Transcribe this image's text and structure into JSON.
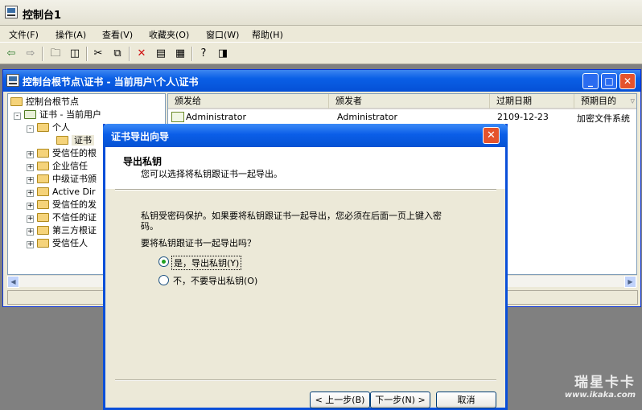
{
  "app": {
    "title": "控制台1"
  },
  "menubar": [
    {
      "label": "文件(F)"
    },
    {
      "label": "操作(A)"
    },
    {
      "label": "查看(V)"
    },
    {
      "label": "收藏夹(O)"
    },
    {
      "label": "窗口(W)"
    },
    {
      "label": "帮助(H)"
    }
  ],
  "toolbar": {
    "icons": [
      "back-icon",
      "forward-icon",
      "up-folder-icon",
      "show-hide-tree-icon",
      "cut-icon",
      "copy-icon",
      "delete-icon",
      "properties-icon",
      "export-list-icon",
      "help-icon",
      "action-pane-icon"
    ]
  },
  "child_window": {
    "title": "控制台根节点\\证书 - 当前用户\\个人\\证书",
    "tree": [
      {
        "label": "控制台根节点",
        "level": 0,
        "expander": "",
        "icon": "folder-icon"
      },
      {
        "label": "证书 - 当前用户",
        "level": 1,
        "expander": "-",
        "icon": "cert-store-icon"
      },
      {
        "label": "个人",
        "level": 2,
        "expander": "-",
        "icon": "folder-icon"
      },
      {
        "label": "证书",
        "level": 3,
        "expander": "",
        "icon": "folder-open-icon",
        "selected": true
      },
      {
        "label": "受信任的根",
        "level": 2,
        "expander": "+",
        "icon": "folder-icon"
      },
      {
        "label": "企业信任",
        "level": 2,
        "expander": "+",
        "icon": "folder-icon"
      },
      {
        "label": "中级证书颁",
        "level": 2,
        "expander": "+",
        "icon": "folder-icon"
      },
      {
        "label": "Active Dir",
        "level": 2,
        "expander": "+",
        "icon": "folder-icon"
      },
      {
        "label": "受信任的发",
        "level": 2,
        "expander": "+",
        "icon": "folder-icon"
      },
      {
        "label": "不信任的证",
        "level": 2,
        "expander": "+",
        "icon": "folder-icon"
      },
      {
        "label": "第三方根证",
        "level": 2,
        "expander": "+",
        "icon": "folder-icon"
      },
      {
        "label": "受信任人",
        "level": 2,
        "expander": "+",
        "icon": "folder-icon"
      }
    ],
    "list_columns": [
      "颁发给",
      "颁发者",
      "过期日期",
      "预期目的"
    ],
    "list_rows": [
      {
        "issued_to": "Administrator",
        "issued_by": "Administrator",
        "expiry": "2109-12-23",
        "purpose": "加密文件系统"
      }
    ]
  },
  "dialog": {
    "title": "证书导出向导",
    "heading": "导出私钥",
    "subheading": "您可以选择将私钥跟证书一起导出。",
    "info_line1": "私钥受密码保护。如果要将私钥跟证书一起导出，您必须在后面一页上键入密",
    "info_line2": "码。",
    "question": "要将私钥跟证书一起导出吗？",
    "options": [
      {
        "label": "是，导出私钥(Y)",
        "selected": true
      },
      {
        "label": "不，不要导出私钥(O)",
        "selected": false
      }
    ],
    "buttons": {
      "back": "< 上一步(B)",
      "next": "下一步(N) >",
      "cancel": "取消"
    }
  },
  "watermark": {
    "brand": "瑞星卡卡",
    "url": "www.ikaka.com"
  }
}
